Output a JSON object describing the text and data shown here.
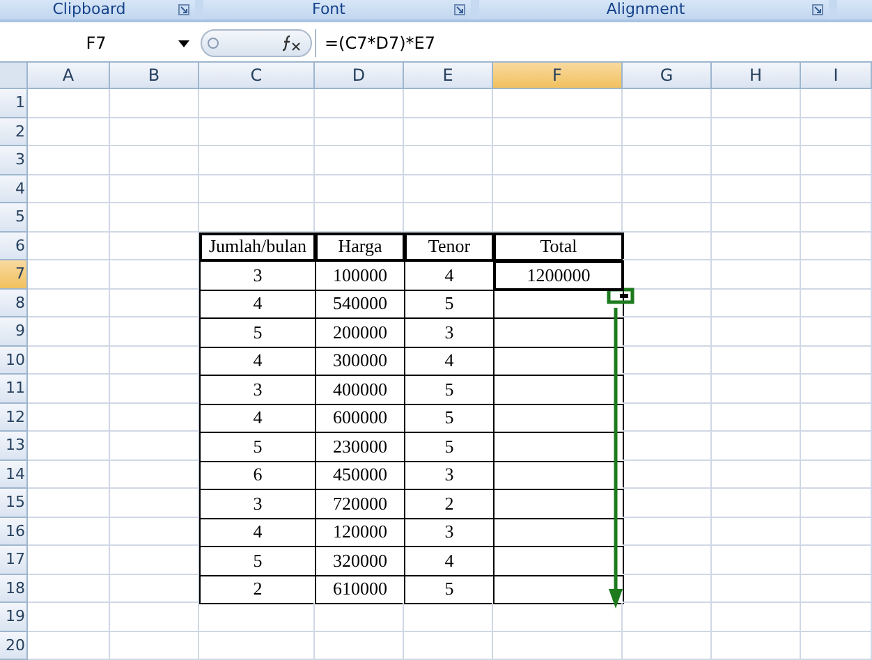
{
  "ribbon_groups": [
    {
      "label": "Clipboard"
    },
    {
      "label": "Font"
    },
    {
      "label": "Alignment"
    }
  ],
  "name_box": "F7",
  "formula": "=(C7*D7)*E7",
  "columns": [
    {
      "label": "A",
      "selected": false
    },
    {
      "label": "B",
      "selected": false
    },
    {
      "label": "C",
      "selected": false
    },
    {
      "label": "D",
      "selected": false
    },
    {
      "label": "E",
      "selected": false
    },
    {
      "label": "F",
      "selected": true
    },
    {
      "label": "G",
      "selected": false
    },
    {
      "label": "H",
      "selected": false
    },
    {
      "label": "I",
      "selected": false
    }
  ],
  "rows": [
    {
      "label": "1",
      "selected": false
    },
    {
      "label": "2",
      "selected": false
    },
    {
      "label": "3",
      "selected": false
    },
    {
      "label": "4",
      "selected": false
    },
    {
      "label": "5",
      "selected": false
    },
    {
      "label": "6",
      "selected": false
    },
    {
      "label": "7",
      "selected": true
    },
    {
      "label": "8",
      "selected": false
    },
    {
      "label": "9",
      "selected": false
    },
    {
      "label": "10",
      "selected": false
    },
    {
      "label": "11",
      "selected": false
    },
    {
      "label": "12",
      "selected": false
    },
    {
      "label": "13",
      "selected": false
    },
    {
      "label": "14",
      "selected": false
    },
    {
      "label": "15",
      "selected": false
    },
    {
      "label": "16",
      "selected": false
    },
    {
      "label": "17",
      "selected": false
    },
    {
      "label": "18",
      "selected": false
    },
    {
      "label": "19",
      "selected": false
    },
    {
      "label": "20",
      "selected": false
    }
  ],
  "table": {
    "columns": [
      "Jumlah/bulan",
      "Harga",
      "Tenor",
      "Total"
    ],
    "rows": [
      [
        "3",
        "100000",
        "4",
        "1200000"
      ],
      [
        "4",
        "540000",
        "5"
      ],
      [
        "5",
        "200000",
        "3"
      ],
      [
        "4",
        "300000",
        "4"
      ],
      [
        "3",
        "400000",
        "5"
      ],
      [
        "4",
        "600000",
        "5"
      ],
      [
        "5",
        "230000",
        "5"
      ],
      [
        "6",
        "450000",
        "3"
      ],
      [
        "3",
        "720000",
        "2"
      ],
      [
        "4",
        "120000",
        "3"
      ],
      [
        "5",
        "320000",
        "4"
      ],
      [
        "2",
        "610000",
        "5"
      ]
    ]
  }
}
